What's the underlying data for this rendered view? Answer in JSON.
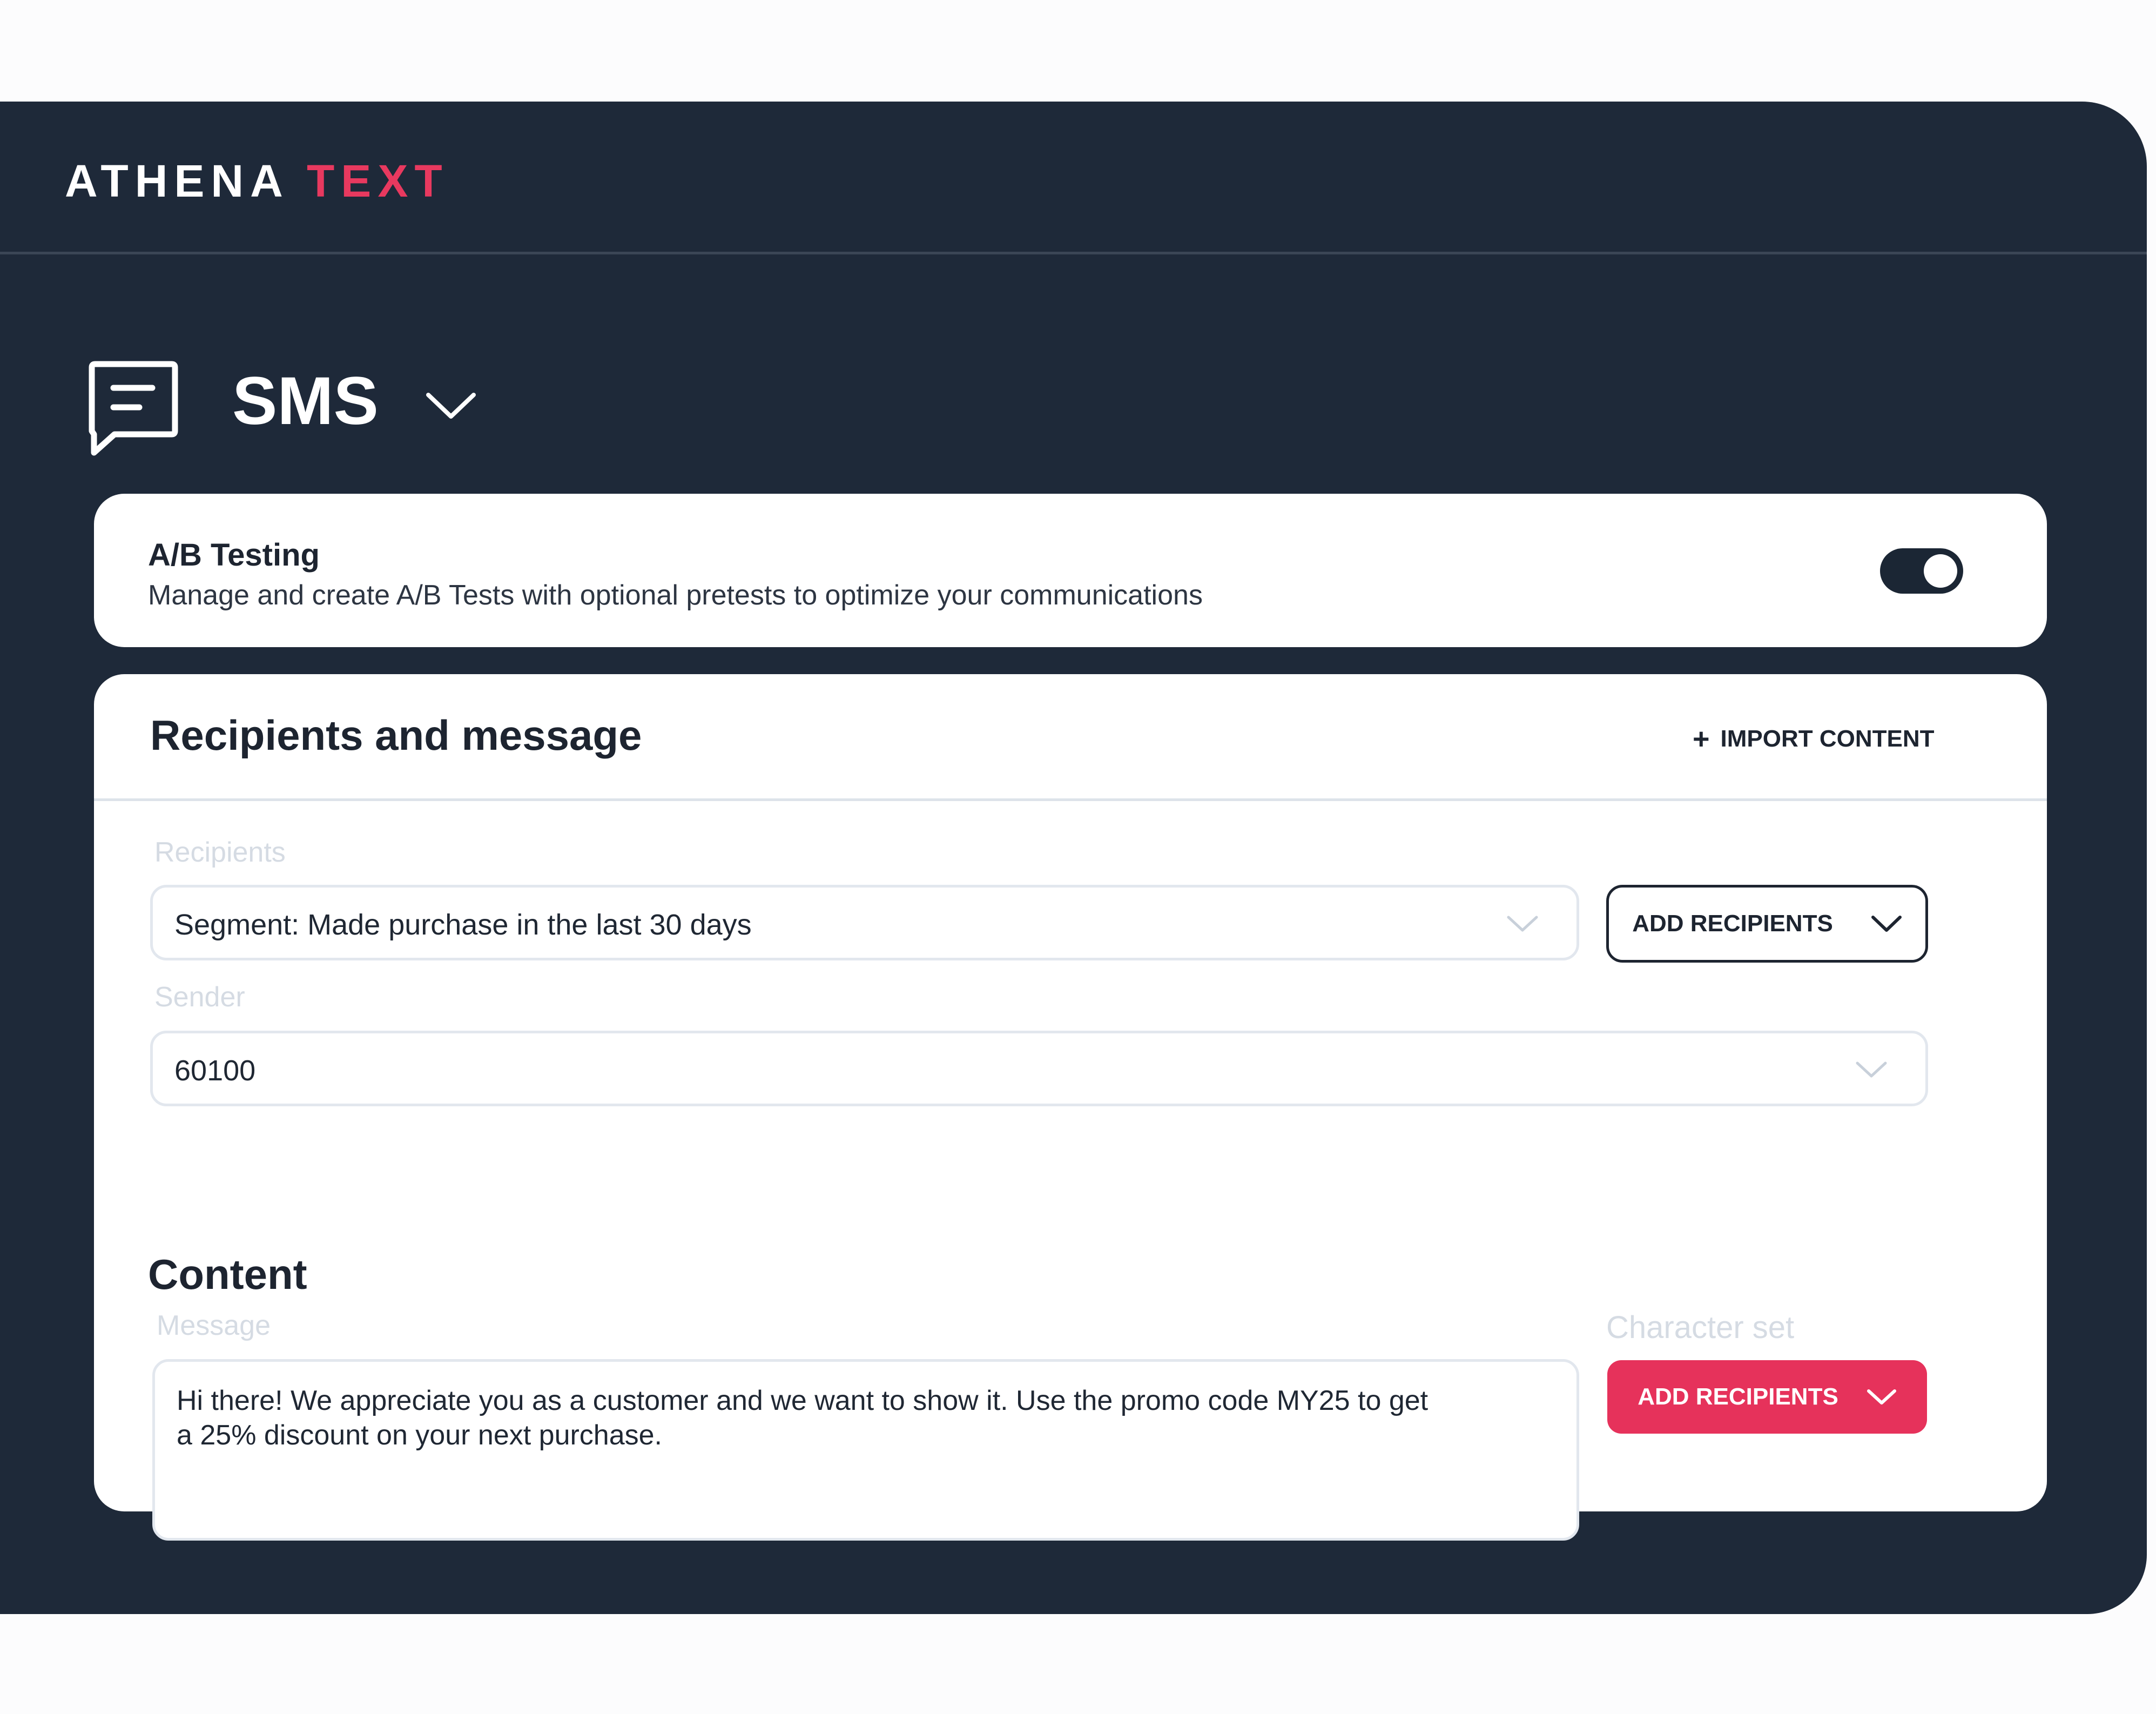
{
  "brand": {
    "part1": "ATHENA",
    "part2": "TEXT"
  },
  "channel": {
    "title": "SMS",
    "icon": "message-square-icon"
  },
  "ab_testing": {
    "title": "A/B Testing",
    "description": "Manage and create A/B Tests with optional pretests to optimize your communications",
    "enabled": true
  },
  "recipients_card": {
    "title": "Recipients and message",
    "import_label": "IMPORT CONTENT",
    "recipients_label": "Recipients",
    "recipients_value": "Segment: Made purchase in the last 30 days",
    "add_recipients_label": "ADD RECIPIENTS",
    "sender_label": "Sender",
    "sender_value": "60100"
  },
  "content": {
    "heading": "Content",
    "message_label": "Message",
    "message_value": "Hi there! We appreciate you as a customer and we want to show it. Use the promo code MY25 to get a 25% discount on your next purchase.",
    "charset_label": "Character set",
    "charset_button_label": "ADD RECIPIENTS"
  },
  "colors": {
    "background": "#1e2939",
    "accent": "#e6325b",
    "card": "#ffffff"
  }
}
